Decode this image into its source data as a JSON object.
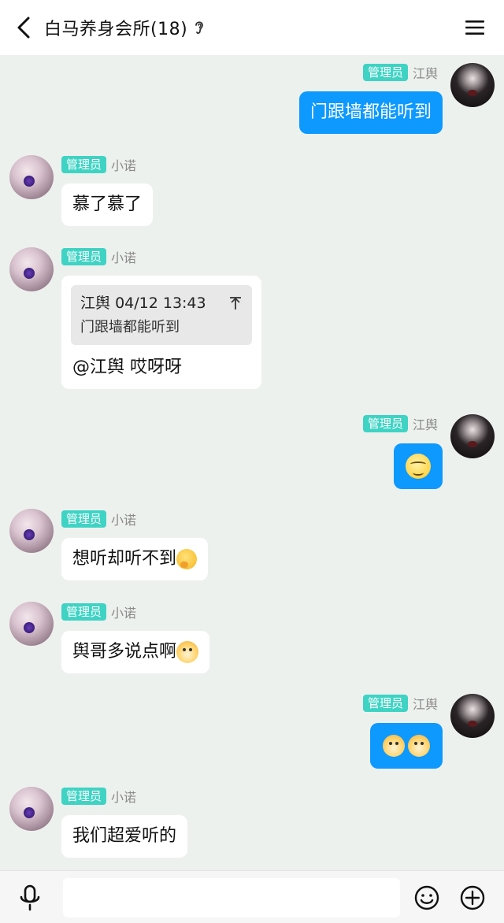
{
  "header": {
    "title": "白马养身会所(18)",
    "back_icon": "chevron-left-icon",
    "ear_icon": "ear-icon",
    "menu_icon": "hamburger-menu-icon"
  },
  "colors": {
    "self_bubble": "#0d99ff",
    "other_bubble": "#ffffff",
    "badge": "#3fd3c4",
    "background": "#edf1ee"
  },
  "messages": [
    {
      "sender": "江舆",
      "badge": "管理员",
      "side": "self",
      "text": "门跟墙都能听到"
    },
    {
      "sender": "小诺",
      "badge": "管理员",
      "side": "other",
      "text": "慕了慕了"
    },
    {
      "sender": "小诺",
      "badge": "管理员",
      "side": "other",
      "quote": {
        "author": "江舆",
        "time": "04/12 13:43",
        "text": "门跟墙都能听到",
        "icon": "scroll-to-quote-icon"
      },
      "text": "@江舆 哎呀呀"
    },
    {
      "sender": "江舆",
      "badge": "管理员",
      "side": "self",
      "emoji": "smirk-emoji"
    },
    {
      "sender": "小诺",
      "badge": "管理员",
      "side": "other",
      "text": "想听却听不到",
      "emoji": "thinking-emoji"
    },
    {
      "sender": "小诺",
      "badge": "管理员",
      "side": "other",
      "text": "舆哥多说点啊",
      "emoji": "doge-emoji"
    },
    {
      "sender": "江舆",
      "badge": "管理员",
      "side": "self",
      "emoji": "doge-emoji x2"
    },
    {
      "sender": "小诺",
      "badge": "管理员",
      "side": "other",
      "text": "我们超爱听的"
    }
  ],
  "input_bar": {
    "placeholder": "",
    "value": "",
    "mic_icon": "microphone-icon",
    "emoji_icon": "smiley-icon",
    "plus_icon": "plus-circle-icon"
  }
}
